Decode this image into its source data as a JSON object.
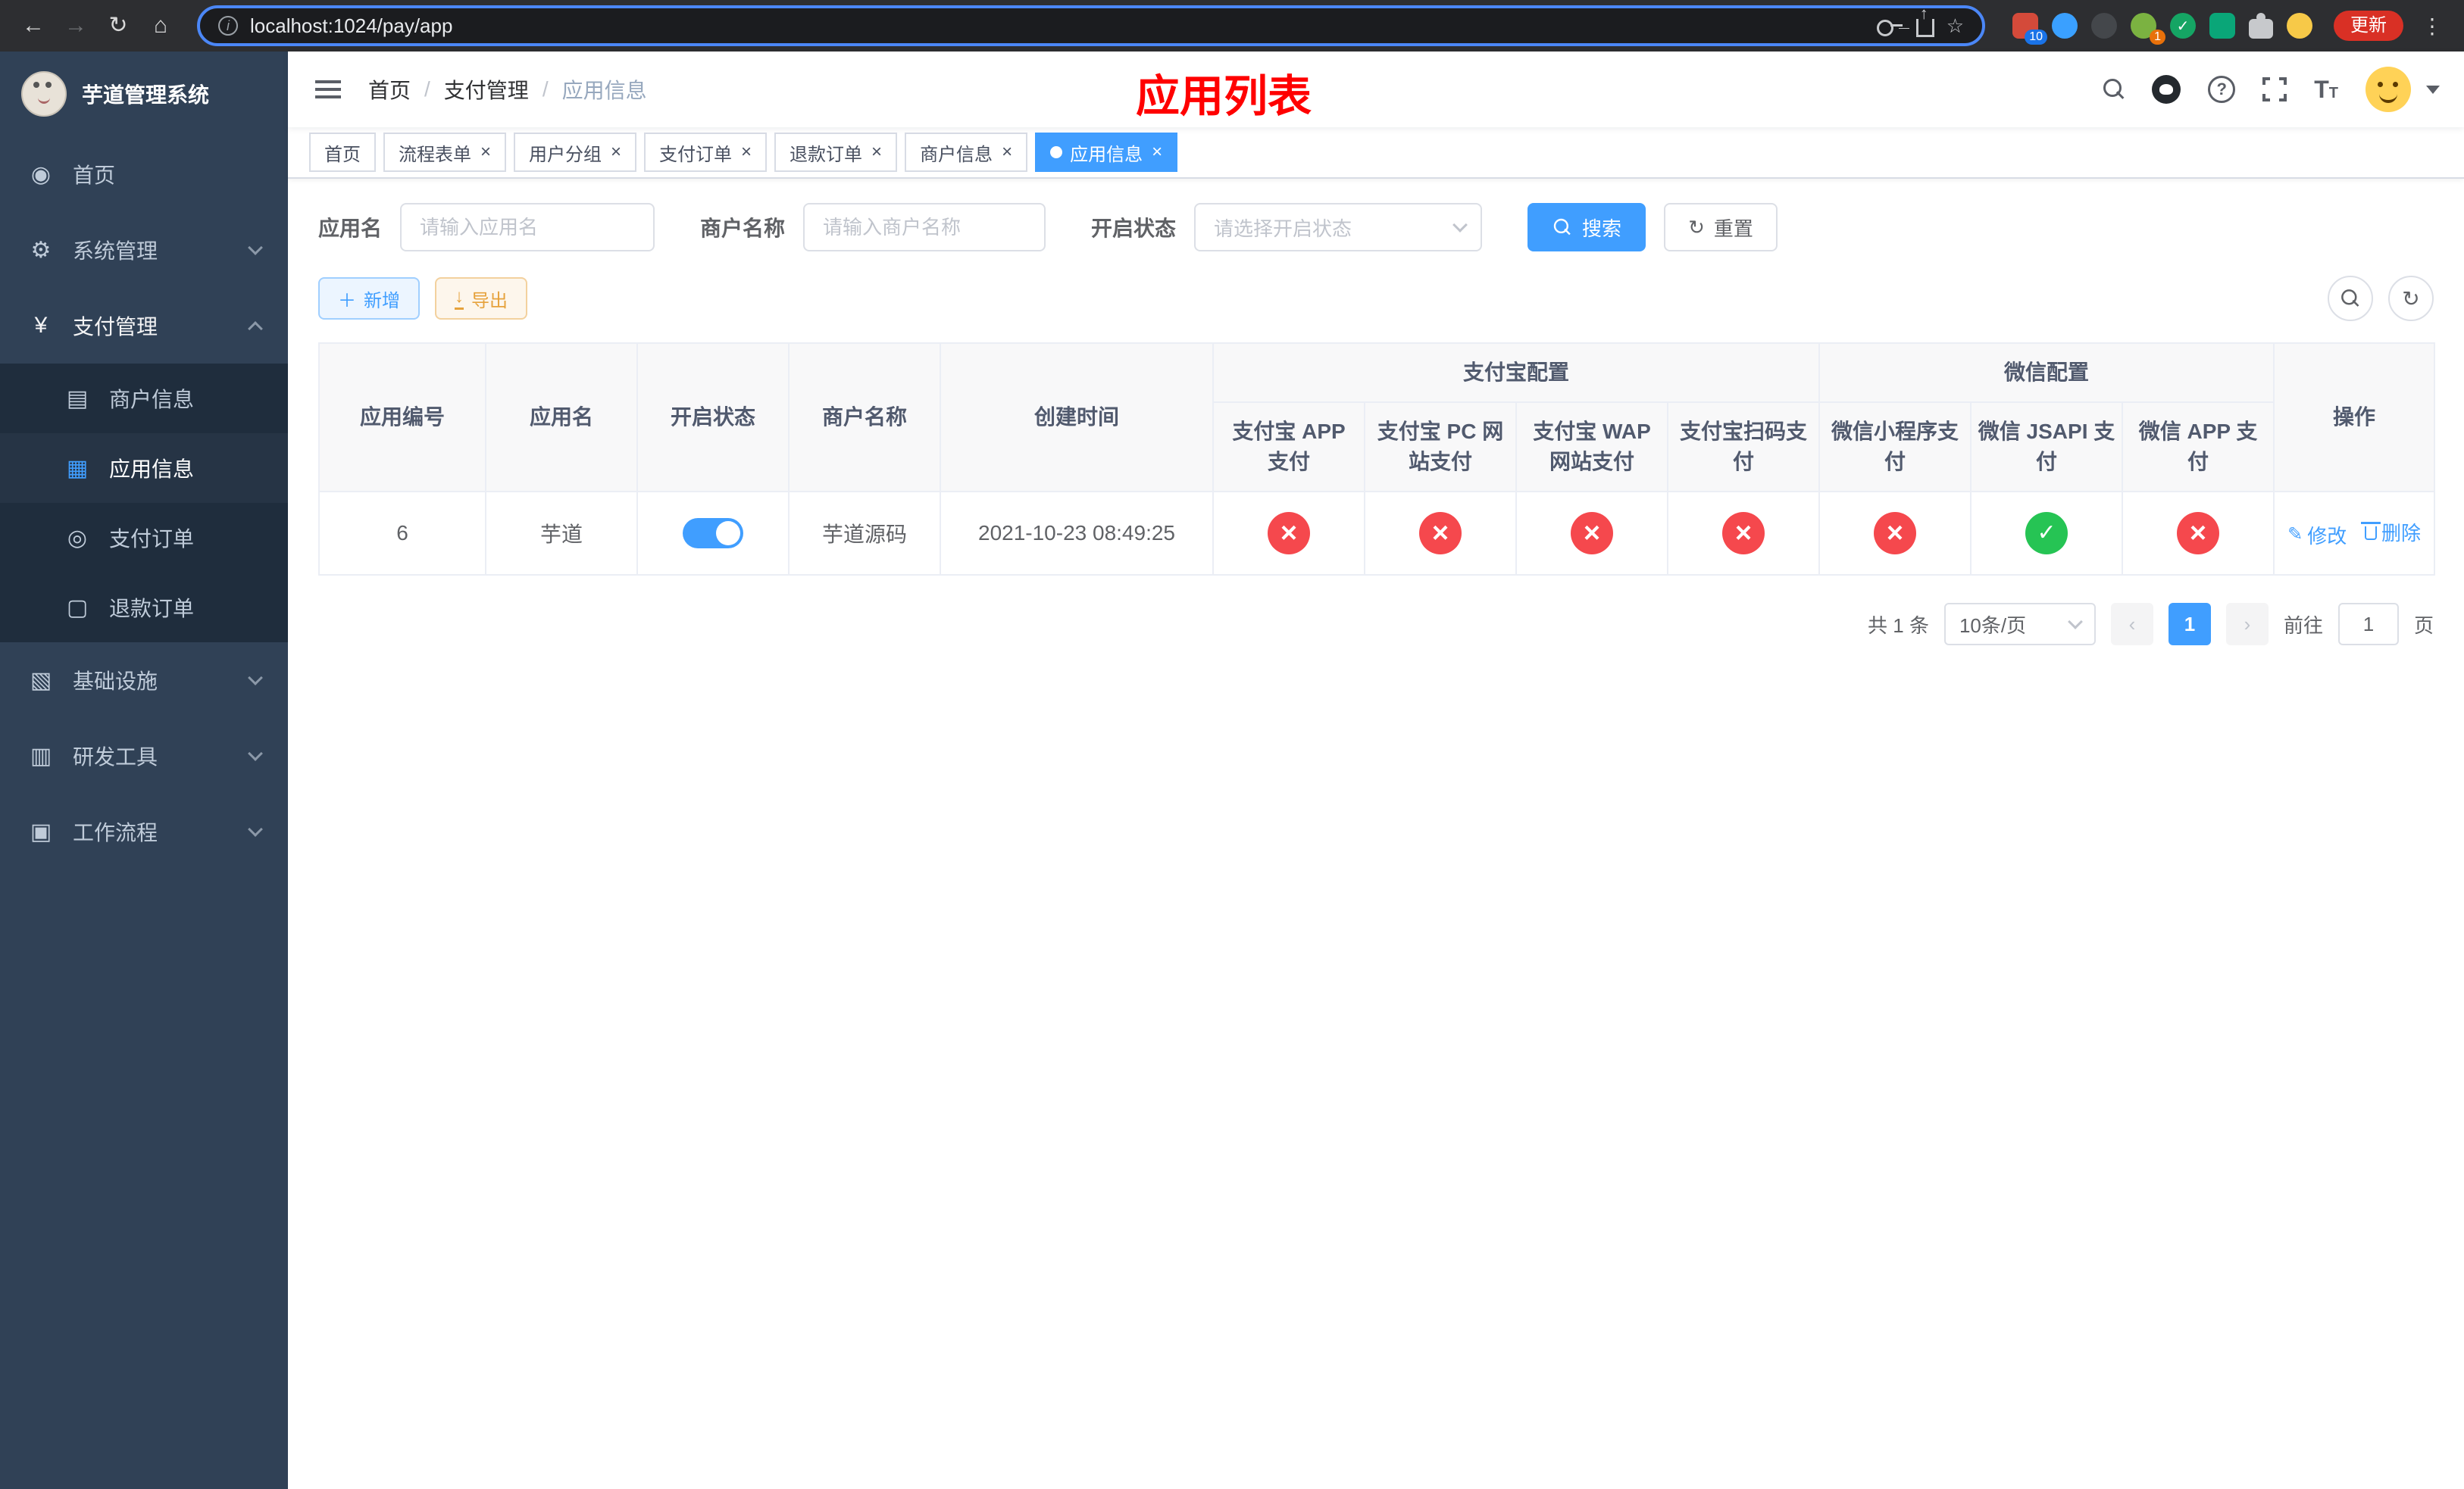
{
  "colors": {
    "primary": "#409eff",
    "danger": "#f5484d",
    "success": "#26c454",
    "warning": "#e6a23c",
    "sidebar": "#304156",
    "submenu": "#1f2d3d",
    "title": "#ff0000"
  },
  "browser": {
    "url": "localhost:1024/pay/app",
    "update_button": "更新",
    "badge_10": "10",
    "badge_1": "1"
  },
  "sidebar": {
    "app_title": "芋道管理系统",
    "items": {
      "home": "首页",
      "system": "系统管理",
      "payment": "支付管理",
      "infra": "基础设施",
      "devtools": "研发工具",
      "workflow": "工作流程"
    },
    "payment_children": {
      "merchant": "商户信息",
      "app": "应用信息",
      "order": "支付订单",
      "refund": "退款订单"
    }
  },
  "header": {
    "breadcrumb": {
      "home": "首页",
      "payment": "支付管理",
      "app": "应用信息"
    },
    "page_title": "应用列表"
  },
  "tabs": [
    {
      "label": "首页",
      "active": false,
      "closable": false
    },
    {
      "label": "流程表单",
      "active": false,
      "closable": true
    },
    {
      "label": "用户分组",
      "active": false,
      "closable": true
    },
    {
      "label": "支付订单",
      "active": false,
      "closable": true
    },
    {
      "label": "退款订单",
      "active": false,
      "closable": true
    },
    {
      "label": "商户信息",
      "active": false,
      "closable": true
    },
    {
      "label": "应用信息",
      "active": true,
      "closable": true
    }
  ],
  "filters": {
    "app_name": {
      "label": "应用名",
      "placeholder": "请输入应用名",
      "value": ""
    },
    "merchant_name": {
      "label": "商户名称",
      "placeholder": "请输入商户名称",
      "value": ""
    },
    "status": {
      "label": "开启状态",
      "placeholder": "请选择开启状态"
    },
    "search": "搜索",
    "reset": "重置"
  },
  "toolbar": {
    "add": "新增",
    "export": "导出"
  },
  "table": {
    "groups": {
      "alipay": "支付宝配置",
      "wechat": "微信配置"
    },
    "headers": {
      "id": "应用编号",
      "name": "应用名",
      "status": "开启状态",
      "merchant": "商户名称",
      "created": "创建时间",
      "alipay_app": "支付宝 APP 支付",
      "alipay_pc": "支付宝 PC 网站支付",
      "alipay_wap": "支付宝 WAP 网站支付",
      "alipay_qr": "支付宝扫码支付",
      "wx_mini": "微信小程序支付",
      "wx_jsapi": "微信 JSAPI 支付",
      "wx_app": "微信 APP 支付",
      "actions": "操作"
    },
    "row": {
      "id": "6",
      "name": "芋道",
      "enabled": true,
      "merchant": "芋道源码",
      "created": "2021-10-23 08:49:25",
      "alipay_app": false,
      "alipay_pc": false,
      "alipay_wap": false,
      "alipay_qr": false,
      "wx_mini": false,
      "wx_jsapi": true,
      "wx_app": false,
      "edit": "修改",
      "delete": "删除"
    }
  },
  "pagination": {
    "total": "共 1 条",
    "page_size": "10条/页",
    "page": "1",
    "prev": "‹",
    "next": "›",
    "goto_label": "前往",
    "goto_value": "1",
    "goto_unit": "页"
  }
}
